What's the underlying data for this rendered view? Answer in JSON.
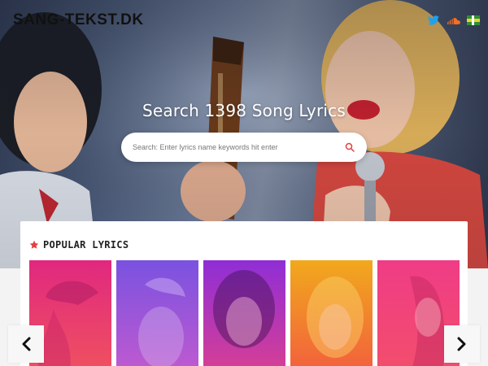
{
  "header": {
    "logo": "SANG-TEKST.DK",
    "social_icons": [
      "twitter-icon",
      "soundcloud-icon",
      "flag-icon"
    ]
  },
  "hero": {
    "title": "Search 1398 Song Lyrics",
    "search": {
      "placeholder": "Search: Enter lyrics name keywords hit enter",
      "value": "",
      "button_icon": "search-icon"
    }
  },
  "popular": {
    "icon": "star-icon",
    "title": "POPULAR LYRICS",
    "cards": [
      {
        "gradient": [
          "#e0287f",
          "#f0525f"
        ]
      },
      {
        "gradient": [
          "#7a52e0",
          "#c15ad0"
        ]
      },
      {
        "gradient": [
          "#8f2ed6",
          "#d83f93"
        ]
      },
      {
        "gradient": [
          "#f1a91d",
          "#f25e3e"
        ]
      },
      {
        "gradient": [
          "#f03c86",
          "#f24e6b"
        ]
      }
    ]
  },
  "nav": {
    "prev_icon": "chevron-left-icon",
    "next_icon": "chevron-right-icon"
  },
  "colors": {
    "accent": "#e53f3f",
    "twitter": "#1da1f2",
    "soundcloud": "#f26f23"
  }
}
